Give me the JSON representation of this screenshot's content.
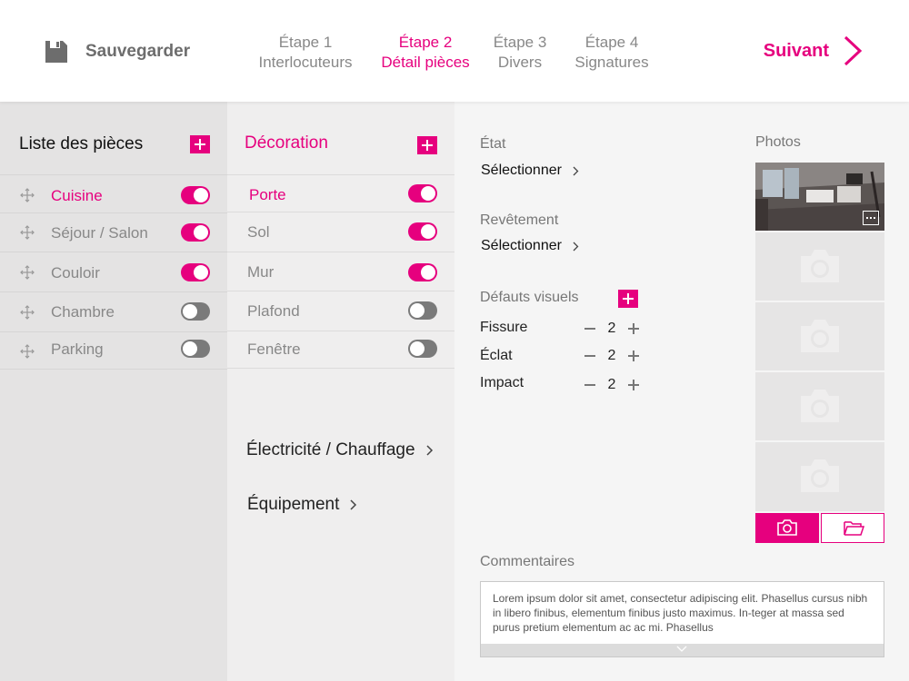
{
  "header": {
    "save_label": "Sauvegarder",
    "next_label": "Suivant",
    "steps": [
      {
        "num": "Étape 1",
        "name": "Interlocuteurs",
        "active": false
      },
      {
        "num": "Étape 2",
        "name": "Détail pièces",
        "active": true
      },
      {
        "num": "Étape 3",
        "name": "Divers",
        "active": false
      },
      {
        "num": "Étape 4",
        "name": "Signatures",
        "active": false
      }
    ]
  },
  "rooms": {
    "title": "Liste des pièces",
    "items": [
      {
        "label": "Cuisine",
        "enabled": true,
        "selected": true
      },
      {
        "label": "Séjour / Salon",
        "enabled": true,
        "selected": false
      },
      {
        "label": "Couloir",
        "enabled": true,
        "selected": false
      },
      {
        "label": "Chambre",
        "enabled": false,
        "selected": false
      },
      {
        "label": "Parking",
        "enabled": false,
        "selected": false
      }
    ]
  },
  "decoration": {
    "title": "Décoration",
    "items": [
      {
        "label": "Porte",
        "enabled": true,
        "selected": true
      },
      {
        "label": "Sol",
        "enabled": true,
        "selected": false
      },
      {
        "label": "Mur",
        "enabled": true,
        "selected": false
      },
      {
        "label": "Plafond",
        "enabled": false,
        "selected": false
      },
      {
        "label": "Fenêtre",
        "enabled": false,
        "selected": false
      }
    ],
    "links": [
      "Électricité / Chauffage",
      "Équipement"
    ]
  },
  "detail": {
    "etat_label": "État",
    "etat_value": "Sélectionner",
    "revetement_label": "Revêtement",
    "revetement_value": "Sélectionner",
    "defauts_label": "Défauts visuels",
    "defects": [
      {
        "label": "Fissure",
        "count": "2"
      },
      {
        "label": "Éclat",
        "count": "2"
      },
      {
        "label": "Impact",
        "count": "2"
      }
    ],
    "photos_label": "Photos",
    "comments_label": "Commentaires",
    "comment_text": "Lorem ipsum dolor sit amet, consectetur adipiscing elit. Phasellus cursus nibh in libero finibus, elementum finibus justo maximus. In-teger at massa sed purus pretium elementum ac ac mi. Phasellus"
  },
  "colors": {
    "accent": "#e6007e",
    "toggle_off": "#7a7a7a"
  }
}
